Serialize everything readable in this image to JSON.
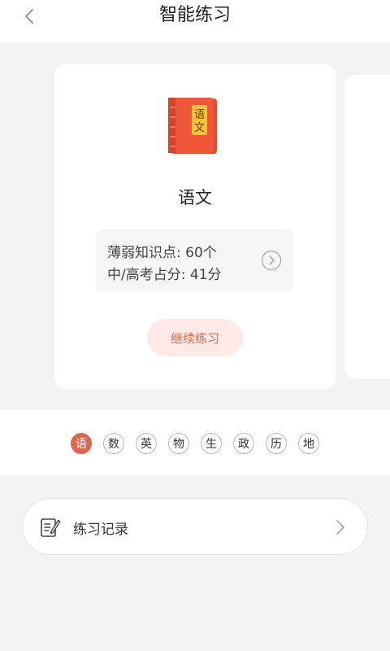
{
  "header": {
    "title": "智能练习"
  },
  "card": {
    "book_label_line1": "语",
    "book_label_line2": "文",
    "subject": "语文",
    "stats": {
      "weak_points": "薄弱知识点: 60个",
      "exam_share": "中/高考占分: 41分"
    },
    "continue_label": "继续练习"
  },
  "subject_tabs": [
    "语",
    "数",
    "英",
    "物",
    "生",
    "政",
    "历",
    "地"
  ],
  "active_tab_index": 0,
  "record": {
    "label": "练习记录"
  },
  "colors": {
    "accent": "#e0654d",
    "button_bg": "#fdeae6",
    "book": "#f0573a",
    "book_label": "#f7c531",
    "page_bg": "#f3f2f4"
  }
}
